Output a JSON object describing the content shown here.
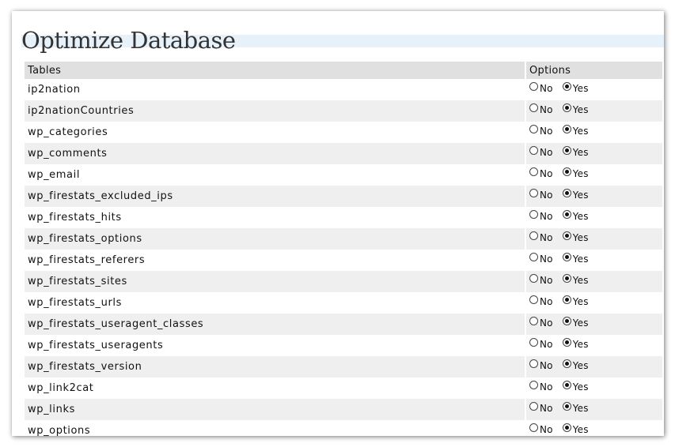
{
  "page": {
    "title": "Optimize Database"
  },
  "table": {
    "headers": {
      "tables": "Tables",
      "options": "Options"
    },
    "option_labels": {
      "no": "No",
      "yes": "Yes"
    },
    "rows": [
      {
        "name": "ip2nation",
        "selected": "yes"
      },
      {
        "name": "ip2nationCountries",
        "selected": "yes"
      },
      {
        "name": "wp_categories",
        "selected": "yes"
      },
      {
        "name": "wp_comments",
        "selected": "yes"
      },
      {
        "name": "wp_email",
        "selected": "yes"
      },
      {
        "name": "wp_firestats_excluded_ips",
        "selected": "yes"
      },
      {
        "name": "wp_firestats_hits",
        "selected": "yes"
      },
      {
        "name": "wp_firestats_options",
        "selected": "yes"
      },
      {
        "name": "wp_firestats_referers",
        "selected": "yes"
      },
      {
        "name": "wp_firestats_sites",
        "selected": "yes"
      },
      {
        "name": "wp_firestats_urls",
        "selected": "yes"
      },
      {
        "name": "wp_firestats_useragent_classes",
        "selected": "yes"
      },
      {
        "name": "wp_firestats_useragents",
        "selected": "yes"
      },
      {
        "name": "wp_firestats_version",
        "selected": "yes"
      },
      {
        "name": "wp_link2cat",
        "selected": "yes"
      },
      {
        "name": "wp_links",
        "selected": "yes"
      },
      {
        "name": "wp_options",
        "selected": "yes"
      }
    ]
  }
}
